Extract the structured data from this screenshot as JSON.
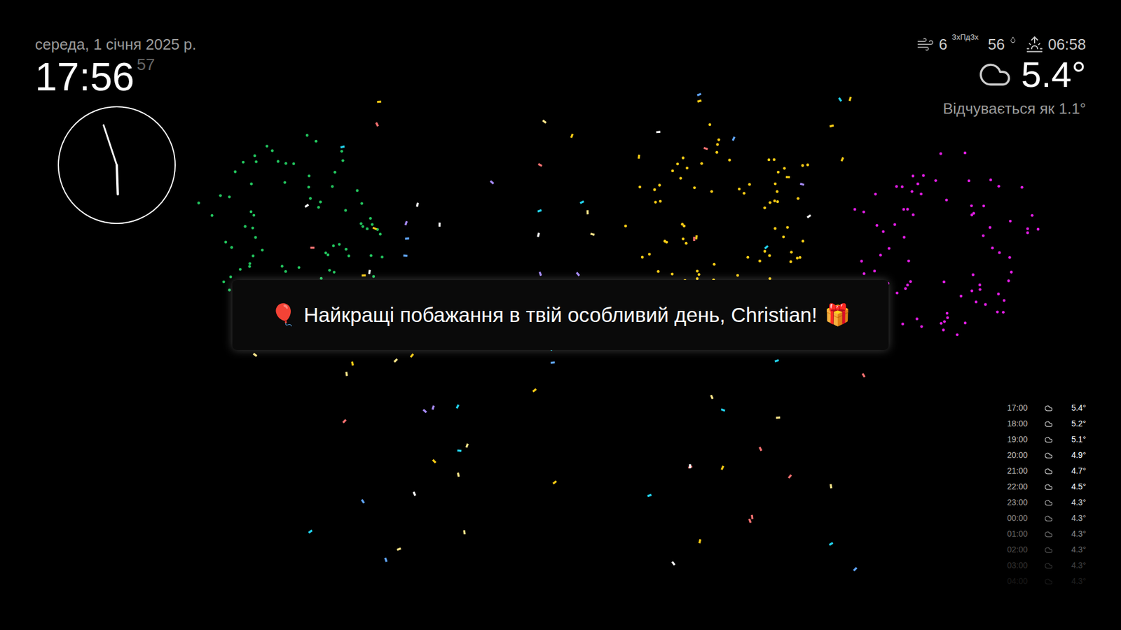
{
  "date": "середа, 1 січня 2025 р.",
  "clock": {
    "time": "17:56",
    "seconds": "57"
  },
  "weather": {
    "wind_speed": "6",
    "wind_direction": "ЗхПдЗх",
    "humidity": "56",
    "sunrise": "06:58",
    "temperature": "5.4°",
    "feels_like": "Відчувається як 1.1°"
  },
  "alert": {
    "icon_start": "🎈",
    "message": "Найкращі побажання в твій особливий день, Christian!",
    "icon_end": "🎁"
  },
  "forecast": [
    {
      "time": "17:00",
      "temp": "5.4°"
    },
    {
      "time": "18:00",
      "temp": "5.2°"
    },
    {
      "time": "19:00",
      "temp": "5.1°"
    },
    {
      "time": "20:00",
      "temp": "4.9°"
    },
    {
      "time": "21:00",
      "temp": "4.7°"
    },
    {
      "time": "22:00",
      "temp": "4.5°"
    },
    {
      "time": "23:00",
      "temp": "4.3°"
    },
    {
      "time": "00:00",
      "temp": "4.3°"
    },
    {
      "time": "01:00",
      "temp": "4.3°"
    },
    {
      "time": "02:00",
      "temp": "4.3°"
    },
    {
      "time": "03:00",
      "temp": "4.3°"
    },
    {
      "time": "04:00",
      "temp": "4.3°"
    }
  ],
  "fireworks": [
    {
      "color": "#22c55e"
    },
    {
      "color": "#facc15"
    },
    {
      "color": "#e11de4"
    }
  ],
  "confetti": {
    "colors": [
      "#facc15",
      "#60a5fa",
      "#a78bfa",
      "#f87171",
      "#ffffff",
      "#22d3ee",
      "#fde68a"
    ]
  }
}
